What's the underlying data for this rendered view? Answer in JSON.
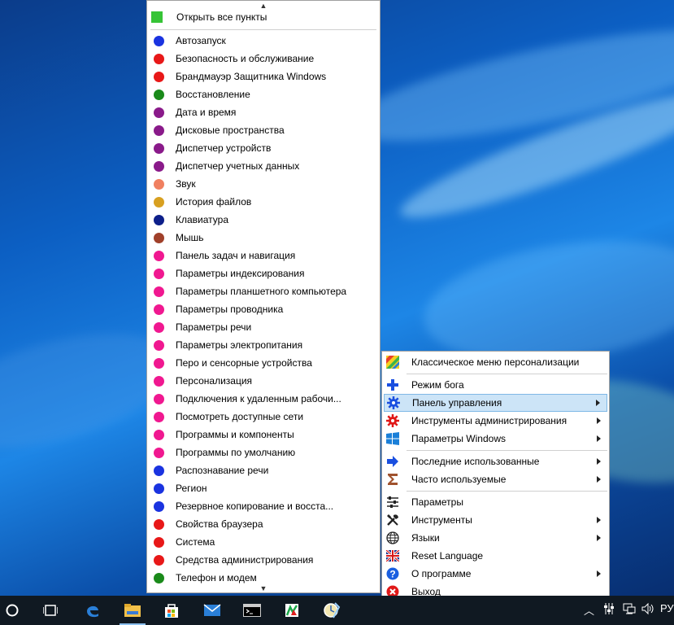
{
  "panel": {
    "open_all": "Открыть все пункты",
    "items": [
      {
        "label": "Автозапуск",
        "color": "#1a33e0"
      },
      {
        "label": "Безопасность и обслуживание",
        "color": "#e81818"
      },
      {
        "label": "Брандмауэр Защитника Windows",
        "color": "#e81818"
      },
      {
        "label": "Восстановление",
        "color": "#1a8a1a"
      },
      {
        "label": "Дата и время",
        "color": "#8a1a8a"
      },
      {
        "label": "Дисковые пространства",
        "color": "#8a1a8a"
      },
      {
        "label": "Диспетчер устройств",
        "color": "#8a1a8a"
      },
      {
        "label": "Диспетчер учетных данных",
        "color": "#8a1a8a"
      },
      {
        "label": "Звук",
        "color": "#f08060"
      },
      {
        "label": "История файлов",
        "color": "#d8a020"
      },
      {
        "label": "Клавиатура",
        "color": "#0d1f8a"
      },
      {
        "label": "Мышь",
        "color": "#a0402a"
      },
      {
        "label": "Панель задач и навигация",
        "color": "#f01890"
      },
      {
        "label": "Параметры индексирования",
        "color": "#f01890"
      },
      {
        "label": "Параметры планшетного компьютера",
        "color": "#f01890"
      },
      {
        "label": "Параметры проводника",
        "color": "#f01890"
      },
      {
        "label": "Параметры речи",
        "color": "#f01890"
      },
      {
        "label": "Параметры электропитания",
        "color": "#f01890"
      },
      {
        "label": "Перо и сенсорные устройства",
        "color": "#f01890"
      },
      {
        "label": "Персонализация",
        "color": "#f01890"
      },
      {
        "label": "Подключения к удаленным рабочи...",
        "color": "#f01890"
      },
      {
        "label": "Посмотреть доступные сети",
        "color": "#f01890"
      },
      {
        "label": "Программы и компоненты",
        "color": "#f01890"
      },
      {
        "label": "Программы по умолчанию",
        "color": "#f01890"
      },
      {
        "label": "Распознавание речи",
        "color": "#1a33e0"
      },
      {
        "label": "Регион",
        "color": "#1a33e0"
      },
      {
        "label": "Резервное копирование и восста...",
        "color": "#1a33e0"
      },
      {
        "label": "Свойства браузера",
        "color": "#e81818"
      },
      {
        "label": "Система",
        "color": "#e81818"
      },
      {
        "label": "Средства администрирования",
        "color": "#e81818"
      },
      {
        "label": "Телефон и модем",
        "color": "#1a8a1a"
      }
    ]
  },
  "menu": {
    "items": [
      {
        "label": "Классическое меню персонализации",
        "icon": "rainbow-icon",
        "sub": false
      },
      {
        "label": "Режим бога",
        "icon": "plus-icon",
        "sub": false
      },
      {
        "label": "Панель управления",
        "icon": "gear-blue-icon",
        "sub": true,
        "highlight": true
      },
      {
        "label": "Инструменты администрирования",
        "icon": "gear-red-icon",
        "sub": true
      },
      {
        "label": "Параметры Windows",
        "icon": "windows-logo-icon",
        "sub": true
      },
      {
        "label": "Последние использованные",
        "icon": "arrow-right-icon",
        "sub": true
      },
      {
        "label": "Часто используемые",
        "icon": "sigma-icon",
        "sub": true
      },
      {
        "label": "Параметры",
        "icon": "sliders-icon",
        "sub": false
      },
      {
        "label": "Инструменты",
        "icon": "tools-icon",
        "sub": true
      },
      {
        "label": "Языки",
        "icon": "globe-icon",
        "sub": true
      },
      {
        "label": "Reset Language",
        "icon": "flag-uk-icon",
        "sub": false
      },
      {
        "label": "О программе",
        "icon": "help-icon",
        "sub": true
      },
      {
        "label": "Выход",
        "icon": "exit-icon",
        "sub": false
      }
    ]
  },
  "tray": {
    "language": "РУ"
  }
}
